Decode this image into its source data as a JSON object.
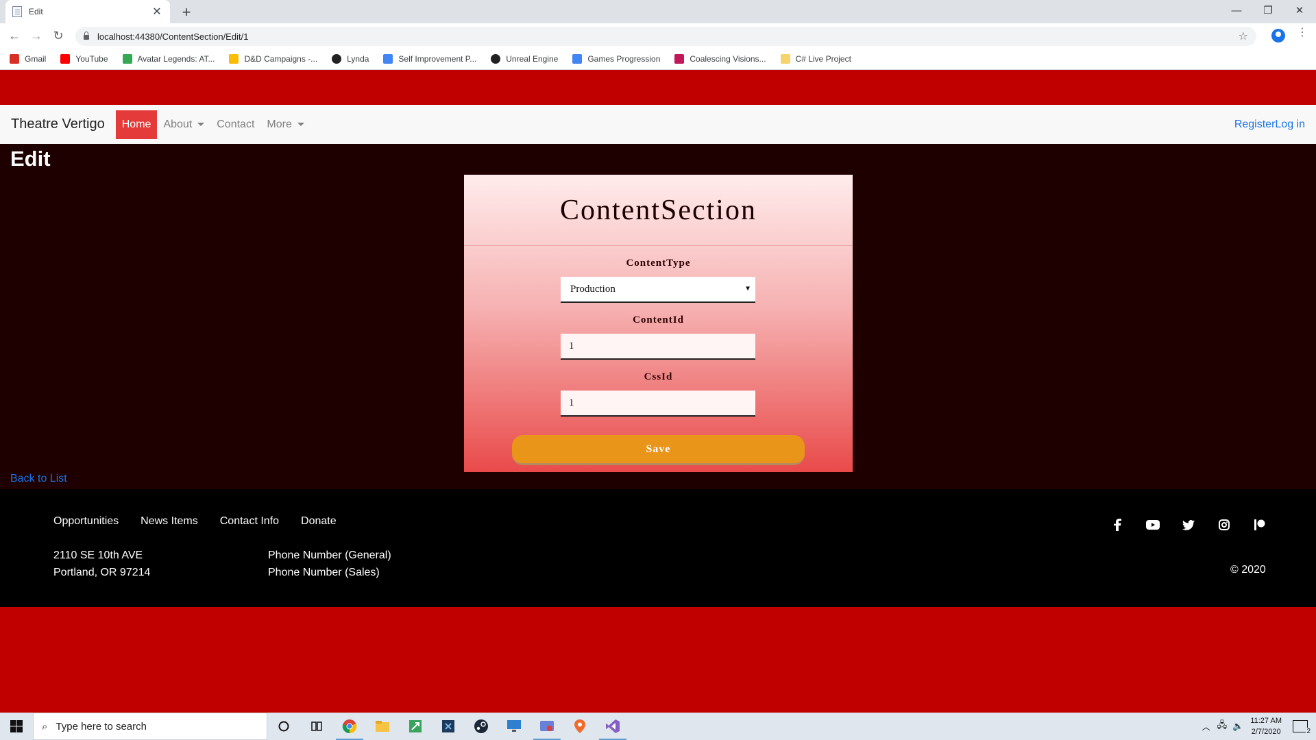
{
  "browser": {
    "tab_title": "Edit",
    "url": "localhost:44380/ContentSection/Edit/1",
    "bookmarks": [
      {
        "label": "Gmail",
        "icon": "gmail-icon",
        "color": "#d93025"
      },
      {
        "label": "YouTube",
        "icon": "youtube-icon",
        "color": "#ff0000"
      },
      {
        "label": "Avatar Legends: AT...",
        "icon": "drive-icon",
        "color": "#34a853"
      },
      {
        "label": "D&D Campaigns -...",
        "icon": "drive-icon",
        "color": "#fbbc04"
      },
      {
        "label": "Lynda",
        "icon": "lynda-icon",
        "color": "#222222"
      },
      {
        "label": "Self Improvement P...",
        "icon": "docs-icon",
        "color": "#4285f4"
      },
      {
        "label": "Unreal Engine",
        "icon": "unreal-icon",
        "color": "#222222"
      },
      {
        "label": "Games Progression",
        "icon": "docs-icon",
        "color": "#4285f4"
      },
      {
        "label": "Coalescing Visions...",
        "icon": "ruby-icon",
        "color": "#c2185b"
      },
      {
        "label": "C# Live Project",
        "icon": "folder-icon",
        "color": "#f6d36b"
      }
    ]
  },
  "site": {
    "brand": "Theatre Vertigo",
    "nav": {
      "home": "Home",
      "about": "About",
      "contact": "Contact",
      "more": "More"
    },
    "register": "Register",
    "login": "Log in"
  },
  "main": {
    "page_title": "Edit",
    "card_title": "ContentSection",
    "fields": {
      "content_type_label": "ContentType",
      "content_type_value": "Production",
      "content_id_label": "ContentId",
      "content_id_value": "1",
      "css_id_label": "CssId",
      "css_id_value": "1"
    },
    "save_label": "Save",
    "back_link": "Back to List"
  },
  "footer": {
    "links": [
      "Opportunities",
      "News Items",
      "Contact Info",
      "Donate"
    ],
    "address_line1": "2110 SE 10th AVE",
    "address_line2": "Portland, OR 97214",
    "phone_general": "Phone Number (General)",
    "phone_sales": "Phone Number (Sales)",
    "copyright": "© 2020",
    "socials": [
      "facebook-icon",
      "youtube-icon",
      "twitter-icon",
      "instagram-icon",
      "patreon-icon"
    ]
  },
  "taskbar": {
    "search_placeholder": "Type here to search",
    "time": "11:27 AM",
    "date": "2/7/2020",
    "notification_count": "2"
  },
  "colors": {
    "page_red": "#c00000",
    "content_bg": "#1f0000",
    "nav_active": "#e53a3a",
    "save_button": "#e8951a",
    "link_blue": "#1a73e8"
  }
}
